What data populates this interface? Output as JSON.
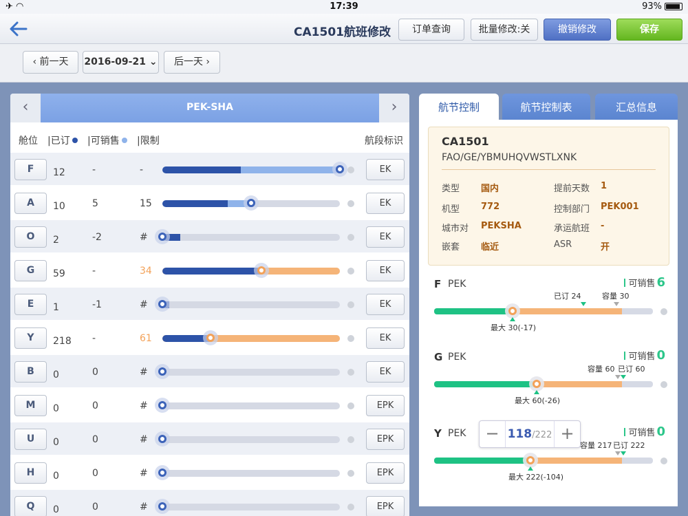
{
  "status": {
    "time": "17:39",
    "battery": "93%"
  },
  "nav": {
    "title": "CA1501航班修改",
    "order_query": "订单查询",
    "batch_edit": "批量修改:关",
    "cancel_edit": "撤销修改",
    "save": "保存"
  },
  "datebar": {
    "prev": "前一天",
    "date": "2016-09-21",
    "next": "后一天"
  },
  "route": {
    "label": "PEK-SHA"
  },
  "columns": {
    "cabin": "舱位",
    "booked": "已订",
    "available": "可销售",
    "limit": "限制",
    "segment": "航段标识"
  },
  "colors": {
    "booked_dot": "#2d53a8",
    "available_dot": "#8fb3ea",
    "orange": "#f3a259",
    "green": "#1ec284"
  },
  "rows": [
    {
      "cabin": "F",
      "booked": "12",
      "available": "-",
      "limit": "-",
      "limit_orange": false,
      "booked_frac": 0.44,
      "light_frac": 1.0,
      "light_color": "#8fb3ea",
      "handle_frac": 1.0,
      "handle_orange": false,
      "segment": "EK"
    },
    {
      "cabin": "A",
      "booked": "10",
      "available": "5",
      "limit": "15",
      "limit_orange": false,
      "booked_frac": 0.37,
      "light_frac": 0.5,
      "light_color": "#8fb3ea",
      "handle_frac": 0.5,
      "handle_orange": false,
      "segment": "EK"
    },
    {
      "cabin": "O",
      "booked": "2",
      "available": "-2",
      "limit": "#",
      "limit_orange": false,
      "booked_frac": 0.1,
      "light_frac": 0,
      "light_color": "#8fb3ea",
      "handle_frac": 0.0,
      "handle_orange": false,
      "segment": "EK"
    },
    {
      "cabin": "G",
      "booked": "59",
      "available": "-",
      "limit": "34",
      "limit_orange": true,
      "booked_frac": 0.56,
      "light_frac": 1.0,
      "light_color": "#f5b478",
      "handle_frac": 0.56,
      "handle_orange": true,
      "segment": "EK"
    },
    {
      "cabin": "E",
      "booked": "1",
      "available": "-1",
      "limit": "#",
      "limit_orange": false,
      "booked_frac": 0.04,
      "light_frac": 0,
      "light_color": "#8fb3ea",
      "handle_frac": 0.0,
      "handle_orange": false,
      "segment": "EK"
    },
    {
      "cabin": "Y",
      "booked": "218",
      "available": "-",
      "limit": "61",
      "limit_orange": true,
      "booked_frac": 0.27,
      "light_frac": 1.0,
      "light_color": "#f5b478",
      "handle_frac": 0.27,
      "handle_orange": true,
      "segment": "EK"
    },
    {
      "cabin": "B",
      "booked": "0",
      "available": "0",
      "limit": "#",
      "limit_orange": false,
      "booked_frac": 0,
      "light_frac": 0,
      "light_color": "#8fb3ea",
      "handle_frac": 0.0,
      "handle_orange": false,
      "segment": "EK"
    },
    {
      "cabin": "M",
      "booked": "0",
      "available": "0",
      "limit": "#",
      "limit_orange": false,
      "booked_frac": 0,
      "light_frac": 0,
      "light_color": "#8fb3ea",
      "handle_frac": 0.0,
      "handle_orange": false,
      "segment": "EPK"
    },
    {
      "cabin": "U",
      "booked": "0",
      "available": "0",
      "limit": "#",
      "limit_orange": false,
      "booked_frac": 0,
      "light_frac": 0,
      "light_color": "#8fb3ea",
      "handle_frac": 0.0,
      "handle_orange": false,
      "segment": "EPK"
    },
    {
      "cabin": "H",
      "booked": "0",
      "available": "0",
      "limit": "#",
      "limit_orange": false,
      "booked_frac": 0,
      "light_frac": 0,
      "light_color": "#8fb3ea",
      "handle_frac": 0.0,
      "handle_orange": false,
      "segment": "EPK"
    },
    {
      "cabin": "Q",
      "booked": "0",
      "available": "0",
      "limit": "#",
      "limit_orange": false,
      "booked_frac": 0,
      "light_frac": 0,
      "light_color": "#8fb3ea",
      "handle_frac": 0.0,
      "handle_orange": false,
      "segment": "EPK"
    }
  ],
  "tabs": [
    "航节控制",
    "航节控制表",
    "汇总信息"
  ],
  "info": {
    "flight_no": "CA1501",
    "path": "FAO/GE/YBMUHQVWSTLXNK",
    "type_label": "类型",
    "type_value": "国内",
    "advance_label": "提前天数",
    "advance_value": "1",
    "aircraft_label": "机型",
    "aircraft_value": "772",
    "dept_label": "控制部门",
    "dept_value": "PEK001",
    "citypair_label": "城市对",
    "citypair_value": "PEKSHA",
    "carrier_label": "承运航班",
    "carrier_value": "-",
    "nest_label": "嵌套",
    "nest_value": "临近",
    "asr_label": "ASR",
    "asr_value": "开"
  },
  "legs": [
    {
      "cabin": "F",
      "city": "PEK",
      "sellable_label": "可销售",
      "sellable": "6",
      "booked_label": "已订 24",
      "capacity_label": "容量 30",
      "max_label": "最大 30(-17)",
      "green_frac": 0.36,
      "orange_frac": 0.86,
      "handle_frac": 0.36
    },
    {
      "cabin": "G",
      "city": "PEK",
      "sellable_label": "可销售",
      "sellable": "0",
      "booked_label": "已订 60",
      "capacity_label": "容量 60",
      "max_label": "最大 60(-26)",
      "green_frac": 0.47,
      "orange_frac": 0.86,
      "handle_frac": 0.47
    },
    {
      "cabin": "Y",
      "city": "PEK",
      "sellable_label": "可销售",
      "sellable": "0",
      "booked_label": "已订 222",
      "capacity_label": "容量 217",
      "max_label": "最大 222(-104)",
      "green_frac": 0.44,
      "orange_frac": 0.86,
      "handle_frac": 0.44,
      "stepper_value": "118",
      "stepper_total": "/222"
    }
  ]
}
